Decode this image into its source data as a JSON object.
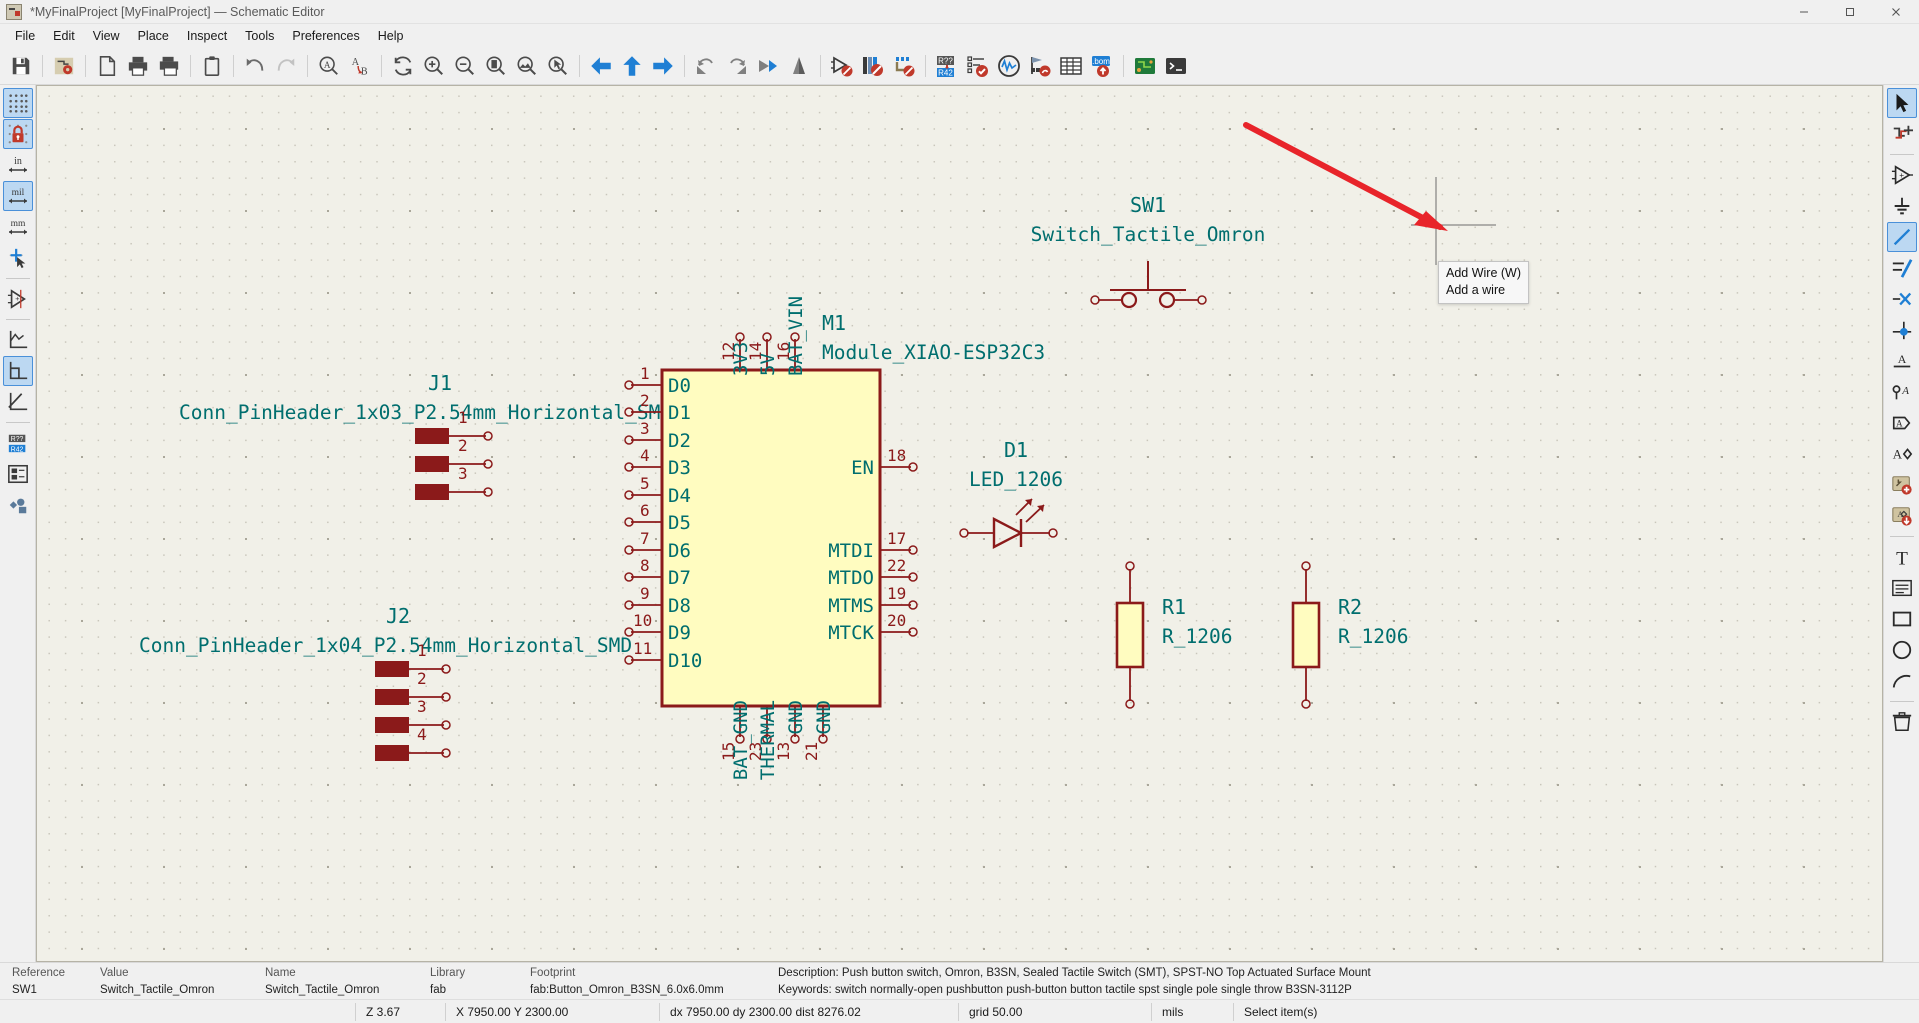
{
  "window": {
    "title": "*MyFinalProject [MyFinalProject] — Schematic Editor",
    "icon": "kicad-schematic-icon",
    "minimize": "—",
    "maximize": "▢",
    "close": "✕"
  },
  "menubar": [
    {
      "label": "File",
      "name": "menu-file"
    },
    {
      "label": "Edit",
      "name": "menu-edit"
    },
    {
      "label": "View",
      "name": "menu-view"
    },
    {
      "label": "Place",
      "name": "menu-place"
    },
    {
      "label": "Inspect",
      "name": "menu-inspect"
    },
    {
      "label": "Tools",
      "name": "menu-tools"
    },
    {
      "label": "Preferences",
      "name": "menu-preferences"
    },
    {
      "label": "Help",
      "name": "menu-help"
    }
  ],
  "toolbar": [
    {
      "name": "save-icon",
      "title": "Save"
    },
    {
      "name": "board-setup-icon",
      "title": "Schematic setup"
    },
    {
      "name": "new-page-icon",
      "title": "Page settings"
    },
    {
      "name": "print-icon",
      "title": "Print"
    },
    {
      "name": "plot-icon",
      "title": "Plot"
    },
    {
      "name": "paste-icon",
      "title": "Paste"
    },
    {
      "name": "undo-icon",
      "title": "Undo"
    },
    {
      "name": "redo-icon",
      "title": "Redo"
    },
    {
      "name": "find-icon",
      "title": "Find"
    },
    {
      "name": "find-replace-icon",
      "title": "Find and replace"
    },
    {
      "name": "refresh-icon",
      "title": "Refresh"
    },
    {
      "name": "zoom-in-icon",
      "title": "Zoom in"
    },
    {
      "name": "zoom-out-icon",
      "title": "Zoom out"
    },
    {
      "name": "zoom-fit-page-icon",
      "title": "Zoom to fit page"
    },
    {
      "name": "zoom-fit-objects-icon",
      "title": "Zoom to objects"
    },
    {
      "name": "zoom-area-icon",
      "title": "Zoom to selection"
    },
    {
      "name": "nav-back-icon",
      "title": "Leave sheet"
    },
    {
      "name": "nav-up-icon",
      "title": "Navigate up"
    },
    {
      "name": "nav-forward-icon",
      "title": "Enter sheet"
    },
    {
      "name": "rotate-ccw-icon",
      "title": "Rotate counterclockwise"
    },
    {
      "name": "rotate-cw-icon",
      "title": "Rotate clockwise"
    },
    {
      "name": "mirror-horizontal-icon",
      "title": "Mirror horizontally"
    },
    {
      "name": "mirror-vertical-icon",
      "title": "Mirror vertically"
    },
    {
      "name": "symbol-editor-icon",
      "title": "Symbol editor"
    },
    {
      "name": "symbol-library-icon",
      "title": "Symbol library browser"
    },
    {
      "name": "footprint-editor-icon",
      "title": "Footprint editor"
    },
    {
      "name": "annotate-icon",
      "title": "Annotate schematic"
    },
    {
      "name": "erc-icon",
      "title": "Electrical rules checker"
    },
    {
      "name": "simulator-icon",
      "title": "Simulator"
    },
    {
      "name": "assign-footprints-icon",
      "title": "Assign footprints"
    },
    {
      "name": "symbol-fields-table-icon",
      "title": "Symbol fields table"
    },
    {
      "name": "bom-icon",
      "title": "Generate BOM"
    },
    {
      "name": "pcb-editor-icon",
      "title": "Open PCB editor"
    },
    {
      "name": "scripting-console-icon",
      "title": "Scripting console"
    }
  ],
  "left_toolbar": [
    {
      "name": "toggle-grid-icon",
      "label": "",
      "active": true
    },
    {
      "name": "grid-lock-icon",
      "label": "",
      "active": true
    },
    {
      "name": "units-inches-icon",
      "label": "in",
      "active": false
    },
    {
      "name": "units-mils-icon",
      "label": "mil",
      "active": true
    },
    {
      "name": "units-mm-icon",
      "label": "mm",
      "active": false
    },
    {
      "name": "toggle-cursor-icon",
      "label": "",
      "active": false
    },
    {
      "name": "show-pin-electrical-type-icon",
      "label": "",
      "active": false
    },
    {
      "name": "line-mode-free-icon",
      "label": "",
      "active": false
    },
    {
      "name": "line-mode-90-icon",
      "label": "",
      "active": true
    },
    {
      "name": "line-mode-45-icon",
      "label": "",
      "active": false
    },
    {
      "name": "annotate-auto-icon",
      "label": "",
      "active": false
    },
    {
      "name": "hierarchy-navigator-icon",
      "label": "",
      "active": false
    },
    {
      "name": "properties-manager-icon",
      "label": "",
      "active": false
    }
  ],
  "right_toolbar": [
    {
      "name": "select-tool-icon",
      "active": true
    },
    {
      "name": "highlight-net-icon",
      "active": false
    },
    {
      "name": "add-symbol-icon",
      "active": false
    },
    {
      "name": "add-power-port-icon",
      "active": false
    },
    {
      "name": "add-wire-icon",
      "active": true
    },
    {
      "name": "add-bus-icon",
      "active": false
    },
    {
      "name": "add-no-connect-icon",
      "active": false
    },
    {
      "name": "add-junction-icon",
      "active": false
    },
    {
      "name": "add-net-label-icon",
      "active": false
    },
    {
      "name": "add-net-class-directive-icon",
      "active": false
    },
    {
      "name": "add-global-label-icon",
      "active": false
    },
    {
      "name": "add-hierarchical-label-icon",
      "active": false
    },
    {
      "name": "add-sheet-icon",
      "active": false
    },
    {
      "name": "import-sheet-pin-icon",
      "active": false
    },
    {
      "name": "add-text-icon",
      "active": false
    },
    {
      "name": "add-textbox-icon",
      "active": false
    },
    {
      "name": "add-rectangle-icon",
      "active": false
    },
    {
      "name": "add-circle-icon",
      "active": false
    },
    {
      "name": "add-arc-icon",
      "active": false
    },
    {
      "name": "delete-tool-icon",
      "active": false
    }
  ],
  "tooltip": {
    "title": "Add Wire  (W)",
    "description": "Add a wire"
  },
  "annotation": {
    "arrow_color": "#e8242a",
    "name": "red-pointer-arrow"
  },
  "schematic": {
    "symbols": [
      {
        "ref": "J1",
        "value": "Conn_PinHeader_1x03_P2.54mm_Horizontal_SMD",
        "pins": [
          "1",
          "2",
          "3"
        ]
      },
      {
        "ref": "J2",
        "value": "Conn_PinHeader_1x04_P2.54mm_Horizontal_SMD",
        "pins": [
          "1",
          "2",
          "3",
          "4"
        ]
      },
      {
        "ref": "M1",
        "value": "Module_XIAO-ESP32C3",
        "left_pins": [
          {
            "num": "1",
            "name": "D0"
          },
          {
            "num": "2",
            "name": "D1"
          },
          {
            "num": "3",
            "name": "D2"
          },
          {
            "num": "4",
            "name": "D3"
          },
          {
            "num": "5",
            "name": "D4"
          },
          {
            "num": "6",
            "name": "D5"
          },
          {
            "num": "7",
            "name": "D6"
          },
          {
            "num": "8",
            "name": "D7"
          },
          {
            "num": "9",
            "name": "D8"
          },
          {
            "num": "10",
            "name": "D9"
          },
          {
            "num": "11",
            "name": "D10"
          }
        ],
        "right_pins": [
          {
            "num": "18",
            "name": "EN"
          },
          {
            "num": "17",
            "name": "MTDI"
          },
          {
            "num": "22",
            "name": "MTDO"
          },
          {
            "num": "19",
            "name": "MTMS"
          },
          {
            "num": "20",
            "name": "MTCK"
          }
        ],
        "top_pins": [
          {
            "num": "12",
            "name": "3V3"
          },
          {
            "num": "14",
            "name": "5V"
          },
          {
            "num": "16",
            "name": "BAT_VIN"
          }
        ],
        "bottom_pins": [
          {
            "num": "15",
            "name": "BAT_GND"
          },
          {
            "num": "23",
            "name": "THERMAL"
          },
          {
            "num": "13",
            "name": "GND"
          },
          {
            "num": "21",
            "name": "GND"
          }
        ]
      },
      {
        "ref": "SW1",
        "value": "Switch_Tactile_Omron"
      },
      {
        "ref": "D1",
        "value": "LED_1206"
      },
      {
        "ref": "R1",
        "value": "R_1206"
      },
      {
        "ref": "R2",
        "value": "R_1206"
      }
    ]
  },
  "message_panel": {
    "columns": [
      {
        "header": "Reference",
        "value": "SW1"
      },
      {
        "header": "Value",
        "value": "Switch_Tactile_Omron"
      },
      {
        "header": "Name",
        "value": "Switch_Tactile_Omron"
      },
      {
        "header": "Library",
        "value": "fab"
      },
      {
        "header": "Footprint",
        "value": "fab:Button_Omron_B3SN_6.0x6.0mm"
      }
    ],
    "description": "Description: Push button switch, Omron, B3SN, Sealed Tactile Switch (SMT), SPST-NO Top Actuated Surface Mount",
    "keywords": "Keywords: switch normally-open pushbutton push-button button tactile spst single pole single throw B3SN-3112P"
  },
  "status_bar": {
    "zoom": "Z 3.67",
    "position": "X 7950.00  Y 2300.00",
    "delta": "dx 7950.00  dy 2300.00  dist 8276.02",
    "grid": "grid 50.00",
    "units": "mils",
    "tool": "Select item(s)"
  },
  "colors": {
    "symbol_body": "#fffcc0",
    "symbol_outline": "#8b1a1a",
    "pin_text": "#006e6e",
    "pin_number": "#8b1a1a",
    "canvas_bg": "#f1f0e8",
    "accent_blue": "#1f7fd4",
    "annotation_red": "#e8242a"
  }
}
